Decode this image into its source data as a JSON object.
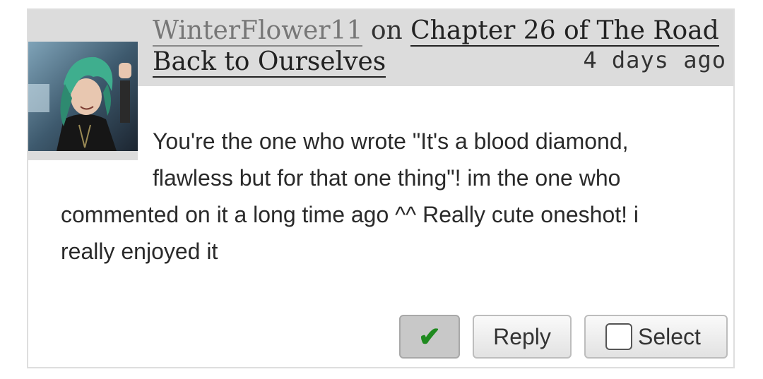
{
  "comment": {
    "author": "WinterFlower11",
    "byline_separator": "on",
    "work_title": "Chapter 26 of The Road Back to Ourselves",
    "timestamp": "4 days ago",
    "text": "You're the one who wrote \"It's a blood diamond, flawless but for that one thing\"! im the one who commented on it a long time ago ^^ Really cute oneshot! i really enjoyed it"
  },
  "actions": {
    "kudos_icon": "check-icon",
    "kudos_glyph": "✔",
    "reply_label": "Reply",
    "select_label": "Select"
  },
  "colors": {
    "header_bg": "#dcdcdc",
    "check_green": "#1f8a1f"
  }
}
